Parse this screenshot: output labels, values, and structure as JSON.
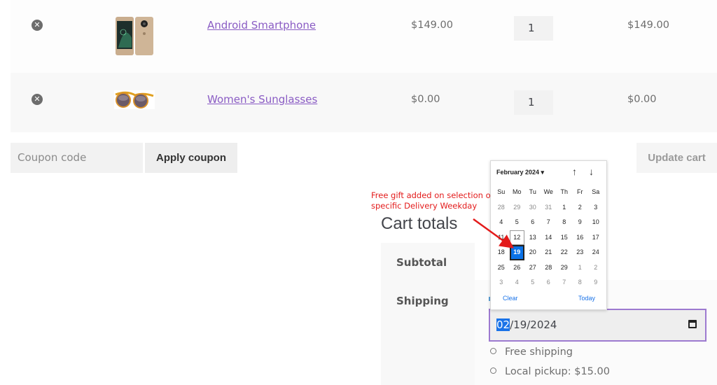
{
  "cart": {
    "items": [
      {
        "name": "Android Smartphone",
        "price": "$149.00",
        "quantity": "1",
        "subtotal": "$149.00",
        "remove_icon": "remove-circle-x-icon",
        "thumbnail": "smartphone-thumbnail"
      },
      {
        "name": "Women's Sunglasses",
        "price": "$0.00",
        "quantity": "1",
        "subtotal": "$0.00",
        "remove_icon": "remove-circle-x-icon",
        "thumbnail": "sunglasses-thumbnail"
      }
    ],
    "coupon_placeholder": "Coupon code",
    "apply_coupon_label": "Apply coupon",
    "update_cart_label": "Update cart"
  },
  "annotation": {
    "text": "Free gift added on selection of specific Delivery Weekday",
    "color": "#e31b1b"
  },
  "totals": {
    "title": "Cart totals",
    "subtotal_label": "Subtotal",
    "shipping_label": "Shipping",
    "delivery_date": {
      "month": "02",
      "rest": "/19/2024",
      "icon": "calendar-icon"
    },
    "shipping_options": [
      "Free shipping",
      "Local pickup: $15.00"
    ]
  },
  "datepicker": {
    "month_label": "February 2024 ▾",
    "nav_up": "↑",
    "nav_down": "↓",
    "weekdays": [
      "Su",
      "Mo",
      "Tu",
      "We",
      "Th",
      "Fr",
      "Sa"
    ],
    "weeks": [
      [
        "28",
        "29",
        "30",
        "31",
        "1",
        "2",
        "3"
      ],
      [
        "4",
        "5",
        "6",
        "7",
        "8",
        "9",
        "10"
      ],
      [
        "11",
        "12",
        "13",
        "14",
        "15",
        "16",
        "17"
      ],
      [
        "18",
        "19",
        "20",
        "21",
        "22",
        "23",
        "24"
      ],
      [
        "25",
        "26",
        "27",
        "28",
        "29",
        "1",
        "2"
      ],
      [
        "3",
        "4",
        "5",
        "6",
        "7",
        "8",
        "9"
      ]
    ],
    "today": "12",
    "selected": "19",
    "clear_label": "Clear",
    "today_label": "Today",
    "accent": "#0a72e8"
  },
  "colors": {
    "link": "#8a5cc4",
    "focus_border": "#9d7ad0"
  }
}
